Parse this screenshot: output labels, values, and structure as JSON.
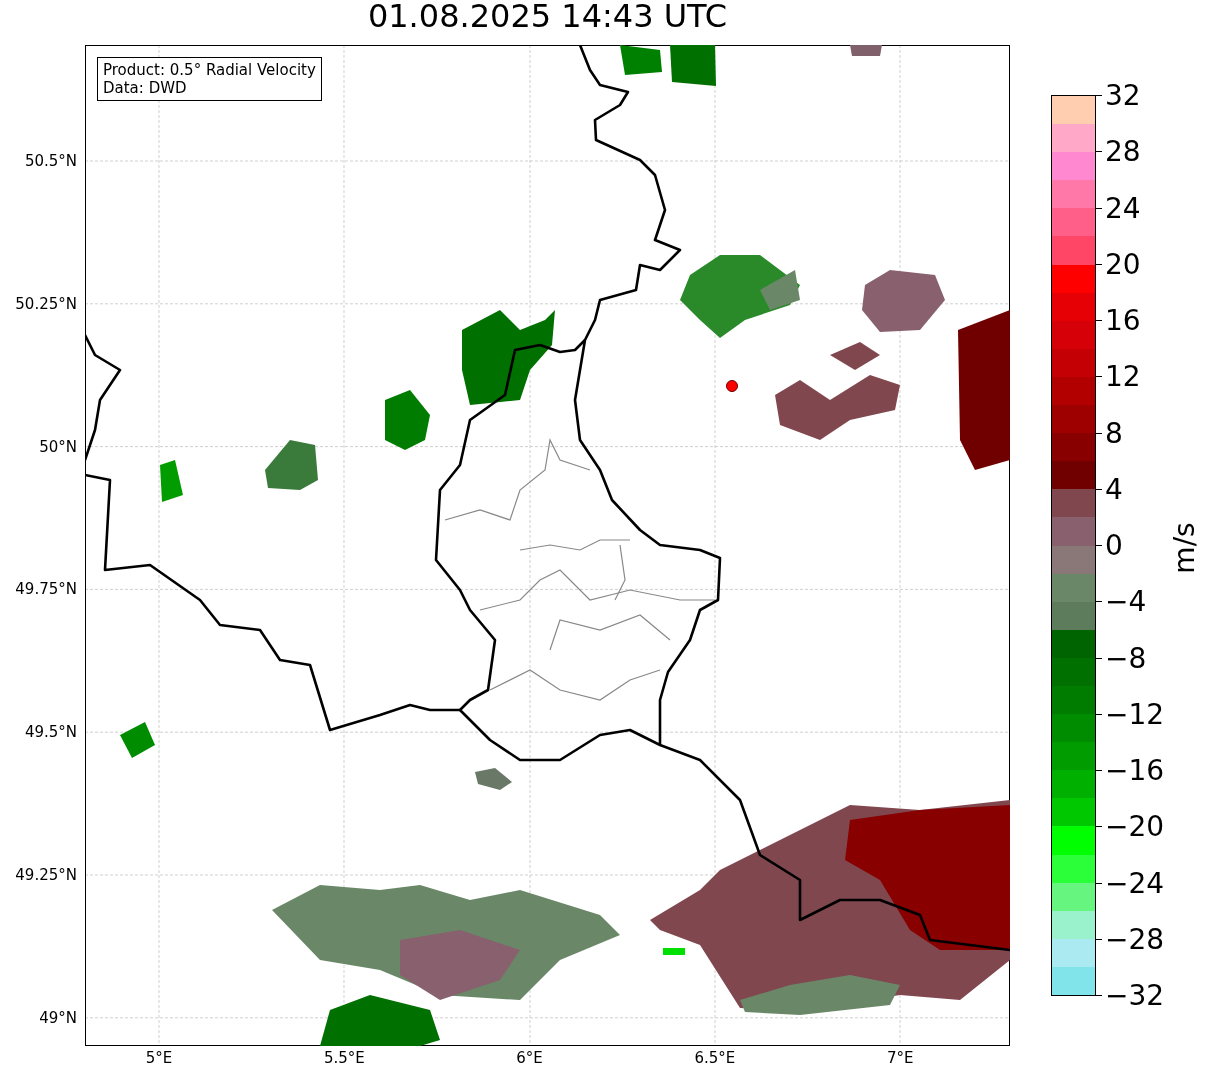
{
  "title": "01.08.2025 14:43 UTC",
  "info_box": {
    "product": "Product: 0.5° Radial Velocity",
    "source": "Data: DWD"
  },
  "latitude_labels": [
    "50.5°N",
    "50.25°N",
    "50°N",
    "49.75°N",
    "49.5°N",
    "49.25°N",
    "49°N"
  ],
  "longitude_labels": [
    "5°E",
    "5.5°E",
    "6°E",
    "6.5°E",
    "7°E"
  ],
  "colorbar": {
    "label": "m/s",
    "ticks": [
      "32",
      "28",
      "24",
      "20",
      "16",
      "12",
      "8",
      "4",
      "0",
      "−4",
      "−8",
      "−12",
      "−16",
      "−20",
      "−24",
      "−28",
      "−32"
    ],
    "segments": [
      {
        "color": "#ffcdb0"
      },
      {
        "color": "#ffa8c8"
      },
      {
        "color": "#ff88d0"
      },
      {
        "color": "#ff78a8"
      },
      {
        "color": "#ff5f88"
      },
      {
        "color": "#ff4666"
      },
      {
        "color": "#ff0000"
      },
      {
        "color": "#e60005"
      },
      {
        "color": "#d50008"
      },
      {
        "color": "#c40005"
      },
      {
        "color": "#b20000"
      },
      {
        "color": "#9e0000"
      },
      {
        "color": "#880000"
      },
      {
        "color": "#700000"
      },
      {
        "color": "#80474f"
      },
      {
        "color": "#88606e"
      },
      {
        "color": "#8a7878"
      },
      {
        "color": "#6a8868"
      },
      {
        "color": "#5c7c5c"
      },
      {
        "color": "#006400"
      },
      {
        "color": "#007000"
      },
      {
        "color": "#007d00"
      },
      {
        "color": "#008c00"
      },
      {
        "color": "#009c00"
      },
      {
        "color": "#00b000"
      },
      {
        "color": "#00c800"
      },
      {
        "color": "#00ff00"
      },
      {
        "color": "#2aff3a"
      },
      {
        "color": "#66f57f"
      },
      {
        "color": "#99f2cc"
      },
      {
        "color": "#aaeaf0"
      },
      {
        "color": "#80e4ea"
      }
    ]
  }
}
